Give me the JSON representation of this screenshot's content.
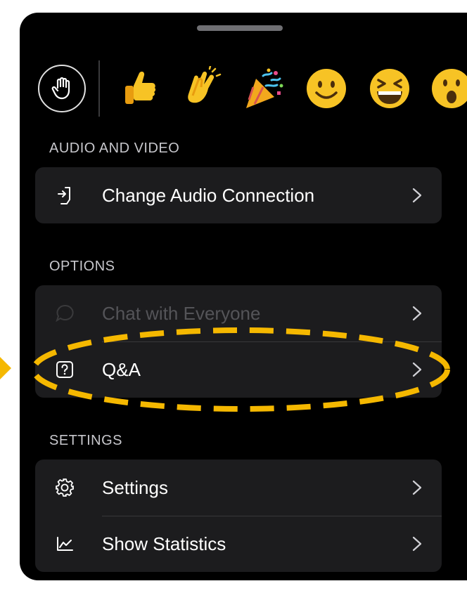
{
  "sections": {
    "audio_video": {
      "label": "AUDIO AND VIDEO",
      "items": [
        {
          "label": "Change Audio Connection",
          "icon": "audio-connection-icon"
        }
      ]
    },
    "options": {
      "label": "OPTIONS",
      "items": [
        {
          "label": "Chat with Everyone",
          "icon": "chat-bubble-icon",
          "disabled": true
        },
        {
          "label": "Q&A",
          "icon": "question-box-icon"
        }
      ]
    },
    "settings": {
      "label": "SETTINGS",
      "items": [
        {
          "label": "Settings",
          "icon": "gear-icon"
        },
        {
          "label": "Show Statistics",
          "icon": "statistics-chart-icon"
        }
      ]
    }
  },
  "reactions": [
    "raise-hand-icon",
    "thumbs-up-emoji",
    "clapping-hands-emoji",
    "party-popper-emoji",
    "smiling-face-emoji",
    "grinning-squinting-face-emoji",
    "surprised-face-emoji"
  ],
  "colors": {
    "sheet_bg": "#000000",
    "card_bg": "#1c1c1e",
    "label_gray": "#c7c7cc",
    "disabled_text": "#545458",
    "annotation": "#f5b800",
    "emoji_yellow": "#f7c325"
  }
}
